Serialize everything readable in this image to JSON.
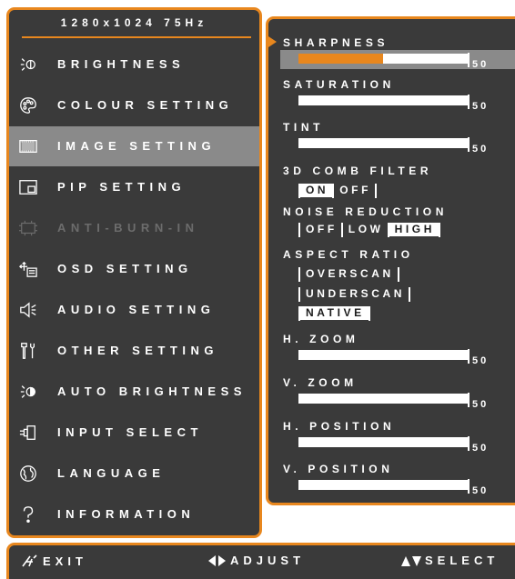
{
  "resolution": "1280x1024 75Hz",
  "menu": [
    {
      "label": "BRIGHTNESS",
      "icon": "brightness-icon",
      "state": "normal"
    },
    {
      "label": "COLOUR SETTING",
      "icon": "palette-icon",
      "state": "normal"
    },
    {
      "label": "IMAGE SETTING",
      "icon": "image-icon",
      "state": "selected"
    },
    {
      "label": "PIP SETTING",
      "icon": "pip-icon",
      "state": "normal"
    },
    {
      "label": "ANTI-BURN-IN",
      "icon": "chip-icon",
      "state": "disabled"
    },
    {
      "label": "OSD SETTING",
      "icon": "osd-icon",
      "state": "normal"
    },
    {
      "label": "AUDIO SETTING",
      "icon": "speaker-icon",
      "state": "normal"
    },
    {
      "label": "OTHER SETTING",
      "icon": "tools-icon",
      "state": "normal"
    },
    {
      "label": "AUTO BRIGHTNESS",
      "icon": "auto-brightness-icon",
      "state": "normal"
    },
    {
      "label": "INPUT SELECT",
      "icon": "input-plug-icon",
      "state": "normal"
    },
    {
      "label": "LANGUAGE",
      "icon": "globe-icon",
      "state": "normal"
    },
    {
      "label": "INFORMATION",
      "icon": "question-icon",
      "state": "normal"
    }
  ],
  "settings": {
    "sharpness": {
      "label": "SHARPNESS",
      "value": "50",
      "level": 0.5
    },
    "saturation": {
      "label": "SATURATION",
      "value": "50",
      "level": 0.5
    },
    "tint": {
      "label": "TINT",
      "value": "50",
      "level": 0.5
    },
    "comb_filter": {
      "label": "3D COMB FILTER",
      "options": [
        "ON",
        "OFF"
      ],
      "selected": "ON"
    },
    "noise_reduction": {
      "label": "NOISE REDUCTION",
      "options": [
        "OFF",
        "LOW",
        "HIGH"
      ],
      "selected": "HIGH"
    },
    "aspect_ratio": {
      "label": "ASPECT RATIO",
      "options": [
        "OVERSCAN",
        "UNDERSCAN",
        "NATIVE"
      ],
      "selected": "NATIVE"
    },
    "h_zoom": {
      "label": "H. ZOOM",
      "value": "50",
      "level": 0.5
    },
    "v_zoom": {
      "label": "V. ZOOM",
      "value": "50",
      "level": 0.5
    },
    "h_position": {
      "label": "H. POSITION",
      "value": "50",
      "level": 0.5
    },
    "v_position": {
      "label": "V. POSITION",
      "value": "50",
      "level": 0.5
    }
  },
  "footer": {
    "exit": "EXIT",
    "adjust": "ADJUST",
    "select": "SELECT"
  },
  "colors": {
    "accent": "#e8871e",
    "panel": "#3a3a3a",
    "highlight": "#8a8a8a",
    "disabled": "#6c6c6c"
  }
}
